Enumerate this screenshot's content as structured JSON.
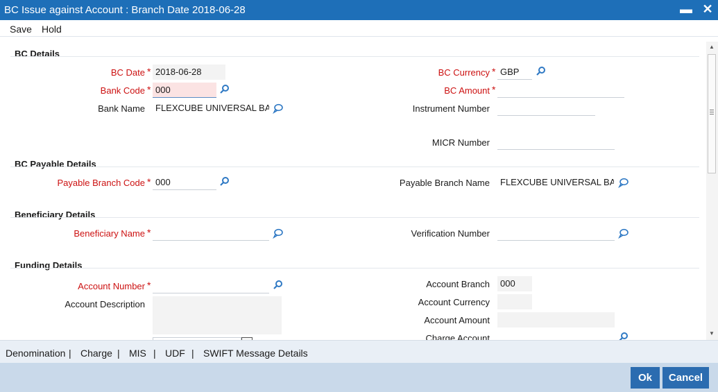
{
  "window": {
    "title": "BC Issue against Account : Branch Date 2018-06-28",
    "minimize": "▬",
    "close": "✕"
  },
  "toolbar": {
    "save": "Save",
    "hold": "Hold"
  },
  "sections": {
    "bc_details": "BC Details",
    "bc_payable": "BC Payable Details",
    "beneficiary": "Beneficiary Details",
    "funding": "Funding Details"
  },
  "fields": {
    "bc_date": {
      "label": "BC Date",
      "value": "2018-06-28"
    },
    "bank_code": {
      "label": "Bank Code",
      "value": "000"
    },
    "bank_name": {
      "label": "Bank Name",
      "value": "FLEXCUBE UNIVERSAL BA"
    },
    "bc_currency": {
      "label": "BC Currency",
      "value": "GBP"
    },
    "bc_amount": {
      "label": "BC Amount",
      "value": ""
    },
    "instrument_number": {
      "label": "Instrument Number",
      "value": ""
    },
    "micr_number": {
      "label": "MICR Number",
      "value": ""
    },
    "payable_branch_code": {
      "label": "Payable Branch Code",
      "value": "000"
    },
    "payable_branch_name": {
      "label": "Payable Branch Name",
      "value": "FLEXCUBE UNIVERSAL BA"
    },
    "beneficiary_name": {
      "label": "Beneficiary Name",
      "value": ""
    },
    "verification_number": {
      "label": "Verification Number",
      "value": ""
    },
    "account_number": {
      "label": "Account Number",
      "value": ""
    },
    "account_description": {
      "label": "Account Description",
      "value": ""
    },
    "account_branch": {
      "label": "Account Branch",
      "value": "000"
    },
    "account_currency": {
      "label": "Account Currency",
      "value": ""
    },
    "account_amount": {
      "label": "Account Amount",
      "value": ""
    },
    "charge_account": {
      "label": "Charge Account",
      "value": ""
    }
  },
  "required_marker": "*",
  "subtabs": [
    "Denomination",
    "Charge",
    "MIS",
    "UDF",
    "SWIFT Message Details"
  ],
  "subtab_separator": "|",
  "footer": {
    "ok": "Ok",
    "cancel": "Cancel"
  },
  "icons": {
    "lookup": "search-icon",
    "details": "speech-bubble-icon"
  },
  "colors": {
    "titlebar": "#1e6fb8",
    "required_label": "#cc1111",
    "button": "#2b6cb0",
    "footer_bg": "#c9d9ea",
    "icon": "#2f79c4"
  }
}
